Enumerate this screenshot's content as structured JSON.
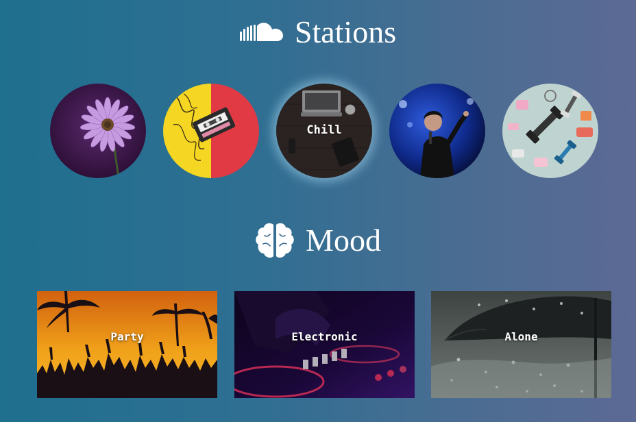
{
  "stations": {
    "title": "Stations",
    "icon": "soundcloud-icon",
    "items": [
      {
        "label": "",
        "image": "purple-flower-image"
      },
      {
        "label": "",
        "image": "cassette-tape-image"
      },
      {
        "label": "Chill",
        "image": "laptop-desk-image"
      },
      {
        "label": "",
        "image": "concert-singer-image"
      },
      {
        "label": "",
        "image": "fitness-dumbbells-image"
      }
    ]
  },
  "mood": {
    "title": "Mood",
    "icon": "brain-icon",
    "items": [
      {
        "label": "Party",
        "image": "sunset-party-crowd-image"
      },
      {
        "label": "Electronic",
        "image": "dj-turntable-image"
      },
      {
        "label": "Alone",
        "image": "umbrella-rain-image"
      }
    ]
  },
  "colors": {
    "background_start": "#1f6f8f",
    "background_end": "#5c6a95",
    "text": "#ffffff",
    "active_glow": "#a0d2eb"
  }
}
